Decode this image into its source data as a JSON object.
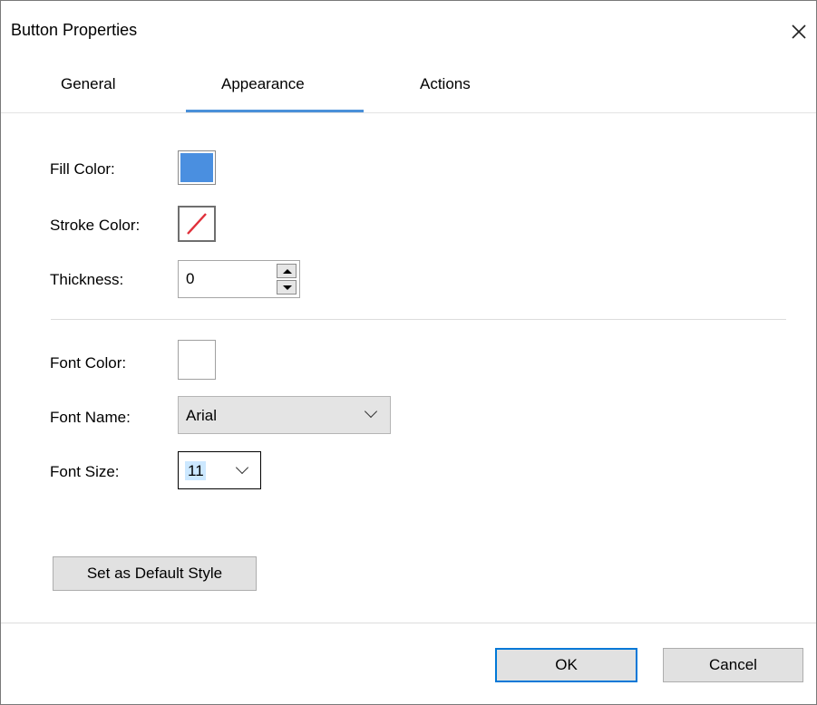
{
  "window": {
    "title": "Button Properties",
    "close_icon": "close-icon"
  },
  "tabs": [
    {
      "label": "General",
      "active": false
    },
    {
      "label": "Appearance",
      "active": true
    },
    {
      "label": "Actions",
      "active": false
    }
  ],
  "appearance": {
    "fill_color": {
      "label": "Fill Color:",
      "color": "#4a8fe0"
    },
    "stroke_color": {
      "label": "Stroke Color:",
      "value": "none",
      "icon": "no-color-slash-icon",
      "slash_color": "#e0303a"
    },
    "thickness": {
      "label": "Thickness:",
      "value": "0"
    },
    "font_color": {
      "label": "Font Color:",
      "color": "#ffffff"
    },
    "font_name": {
      "label": "Font Name:",
      "value": "Arial"
    },
    "font_size": {
      "label": "Font Size:",
      "value": "11"
    },
    "default_button": "Set as Default Style"
  },
  "footer": {
    "ok": "OK",
    "cancel": "Cancel"
  },
  "colors": {
    "accent": "#4a90d9",
    "ok_border": "#0078d7",
    "selection": "#cce8ff"
  }
}
